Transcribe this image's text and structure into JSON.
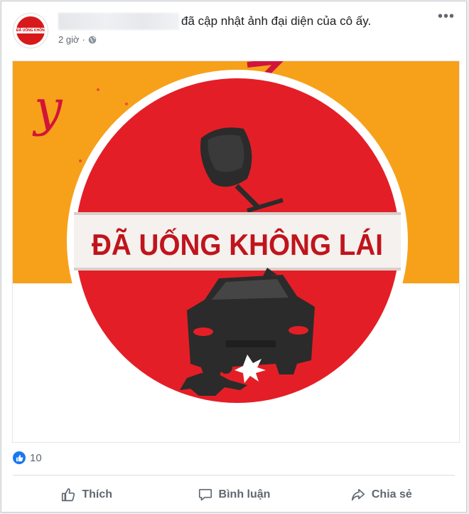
{
  "post": {
    "avatar_text": "ĐÃ UỐNG KHÔNG LÁI",
    "action_text": "đã cập nhật ảnh đại diện của cô ấy.",
    "time": "2 giờ",
    "privacy_icon": "globe-icon",
    "more_label": "•••"
  },
  "photo": {
    "banner_text": "ĐÃ UỐNG KHÔNG LÁI",
    "script_letter": "y",
    "colors": {
      "orange": "#f7a11a",
      "red": "#e41e26",
      "dark": "#2b2b2b"
    }
  },
  "reactions": {
    "icon": "like-badge-icon",
    "count": "10"
  },
  "actions": {
    "like": "Thích",
    "comment": "Bình luận",
    "share": "Chia sẻ"
  }
}
